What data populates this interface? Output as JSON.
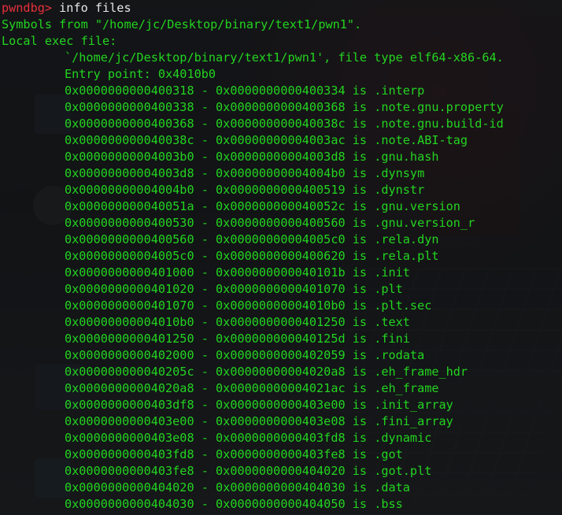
{
  "prompt": {
    "name": "pwndbg>",
    "command": " info files"
  },
  "header": {
    "symbols_line": "Symbols from \"/home/jc/Desktop/binary/text1/pwn1\".",
    "local_exec_line": "Local exec file:",
    "file_line": "`/home/jc/Desktop/binary/text1/pwn1', file type elf64-x86-64.",
    "entry_line": "Entry point: 0x4010b0"
  },
  "sections": [
    {
      "start": "0x0000000000400318",
      "end": "0x0000000000400334",
      "name": ".interp"
    },
    {
      "start": "0x0000000000400338",
      "end": "0x0000000000400368",
      "name": ".note.gnu.property"
    },
    {
      "start": "0x0000000000400368",
      "end": "0x000000000040038c",
      "name": ".note.gnu.build-id"
    },
    {
      "start": "0x000000000040038c",
      "end": "0x00000000004003ac",
      "name": ".note.ABI-tag"
    },
    {
      "start": "0x00000000004003b0",
      "end": "0x00000000004003d8",
      "name": ".gnu.hash"
    },
    {
      "start": "0x00000000004003d8",
      "end": "0x00000000004004b0",
      "name": ".dynsym"
    },
    {
      "start": "0x00000000004004b0",
      "end": "0x0000000000400519",
      "name": ".dynstr"
    },
    {
      "start": "0x000000000040051a",
      "end": "0x000000000040052c",
      "name": ".gnu.version"
    },
    {
      "start": "0x0000000000400530",
      "end": "0x0000000000400560",
      "name": ".gnu.version_r"
    },
    {
      "start": "0x0000000000400560",
      "end": "0x00000000004005c0",
      "name": ".rela.dyn"
    },
    {
      "start": "0x00000000004005c0",
      "end": "0x0000000000400620",
      "name": ".rela.plt"
    },
    {
      "start": "0x0000000000401000",
      "end": "0x000000000040101b",
      "name": ".init"
    },
    {
      "start": "0x0000000000401020",
      "end": "0x0000000000401070",
      "name": ".plt"
    },
    {
      "start": "0x0000000000401070",
      "end": "0x00000000004010b0",
      "name": ".plt.sec"
    },
    {
      "start": "0x00000000004010b0",
      "end": "0x0000000000401250",
      "name": ".text"
    },
    {
      "start": "0x0000000000401250",
      "end": "0x000000000040125d",
      "name": ".fini"
    },
    {
      "start": "0x0000000000402000",
      "end": "0x0000000000402059",
      "name": ".rodata"
    },
    {
      "start": "0x000000000040205c",
      "end": "0x00000000004020a8",
      "name": ".eh_frame_hdr"
    },
    {
      "start": "0x00000000004020a8",
      "end": "0x00000000004021ac",
      "name": ".eh_frame"
    },
    {
      "start": "0x0000000000403df8",
      "end": "0x0000000000403e00",
      "name": ".init_array"
    },
    {
      "start": "0x0000000000403e00",
      "end": "0x0000000000403e08",
      "name": ".fini_array"
    },
    {
      "start": "0x0000000000403e08",
      "end": "0x0000000000403fd8",
      "name": ".dynamic"
    },
    {
      "start": "0x0000000000403fd8",
      "end": "0x0000000000403fe8",
      "name": ".got"
    },
    {
      "start": "0x0000000000403fe8",
      "end": "0x0000000000404020",
      "name": ".got.plt"
    },
    {
      "start": "0x0000000000404020",
      "end": "0x0000000000404030",
      "name": ".data"
    },
    {
      "start": "0x0000000000404030",
      "end": "0x0000000000404050",
      "name": ".bss"
    }
  ],
  "separator": " - ",
  "is_word": " is ",
  "colors": {
    "prompt": "#e8303b",
    "output": "#23d420",
    "command": "#e8e8e8"
  }
}
